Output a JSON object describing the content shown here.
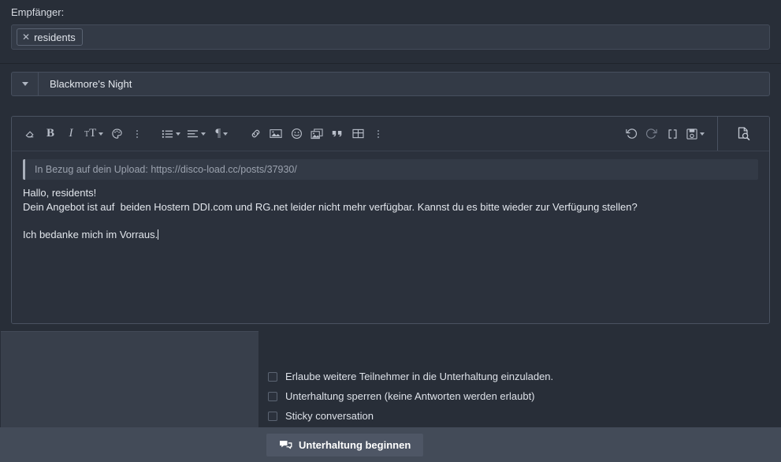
{
  "recipients": {
    "label": "Empfänger:",
    "tokens": [
      {
        "remove_icon": "close-icon",
        "name": "residents"
      }
    ]
  },
  "title_row": {
    "prefix_icon": "chevron-down-icon",
    "title": "Blackmore's Night"
  },
  "editor": {
    "toolbar_left": [
      {
        "icon": "remove-formatting-icon",
        "label": "◇"
      },
      {
        "icon": "bold-icon",
        "label": "B"
      },
      {
        "icon": "italic-icon",
        "label": "I"
      },
      {
        "icon": "font-size-icon",
        "label": "TT",
        "has_caret": true
      },
      {
        "icon": "text-color-palette-icon",
        "label": "palette"
      },
      {
        "icon": "more-text-options-icon",
        "label": "⋮"
      },
      {
        "icon": "bullet-list-icon",
        "label": "list",
        "has_caret": true
      },
      {
        "icon": "text-align-icon",
        "label": "align",
        "has_caret": true
      },
      {
        "icon": "paragraph-format-icon",
        "label": "¶",
        "has_caret": true
      },
      {
        "icon": "link-icon",
        "label": "link"
      },
      {
        "icon": "insert-image-icon",
        "label": "image"
      },
      {
        "icon": "smilie-icon",
        "label": "emoji"
      },
      {
        "icon": "media-gallery-icon",
        "label": "gallery"
      },
      {
        "icon": "quote-icon",
        "label": "❞"
      },
      {
        "icon": "table-icon",
        "label": "table"
      },
      {
        "icon": "more-insert-options-icon",
        "label": "⋮"
      }
    ],
    "toolbar_right": [
      {
        "icon": "undo-icon",
        "label": "undo"
      },
      {
        "icon": "redo-icon",
        "label": "redo"
      },
      {
        "icon": "bbcode-icon",
        "label": "[ ]"
      },
      {
        "icon": "drafts-save-icon",
        "label": "save",
        "has_caret": true
      }
    ],
    "preview_button": {
      "icon": "preview-document-icon",
      "label": "Preview"
    },
    "quote": "In Bezug auf dein Upload: https://disco-load.cc/posts/37930/",
    "message_lines": [
      "Hallo, residents!",
      "Dein Angebot ist auf  beiden Hostern DDI.com und RG.net leider nicht mehr verfügbar. Kannst du es bitte wieder zur Verfügung stellen?",
      "",
      "Ich bedanke mich im Vorraus."
    ]
  },
  "options": {
    "checkboxes": [
      {
        "checked": false,
        "label": "Erlaube weitere Teilnehmer in die Unterhaltung einzuladen."
      },
      {
        "checked": false,
        "label": "Unterhaltung sperren (keine Antworten werden erlaubt)"
      },
      {
        "checked": false,
        "label": "Sticky conversation"
      }
    ]
  },
  "actions": {
    "submit": {
      "icon": "conversation-bubbles-icon",
      "label": "Unterhaltung beginnen"
    }
  },
  "colors": {
    "page_bg": "#282e38",
    "panel_bg": "#2b313c",
    "field_bg": "#333a46",
    "action_bar_bg": "#434b58",
    "accent_blue": "#2f6fd0",
    "text": "#e2e6ec",
    "muted_text": "#9ba2ae"
  }
}
